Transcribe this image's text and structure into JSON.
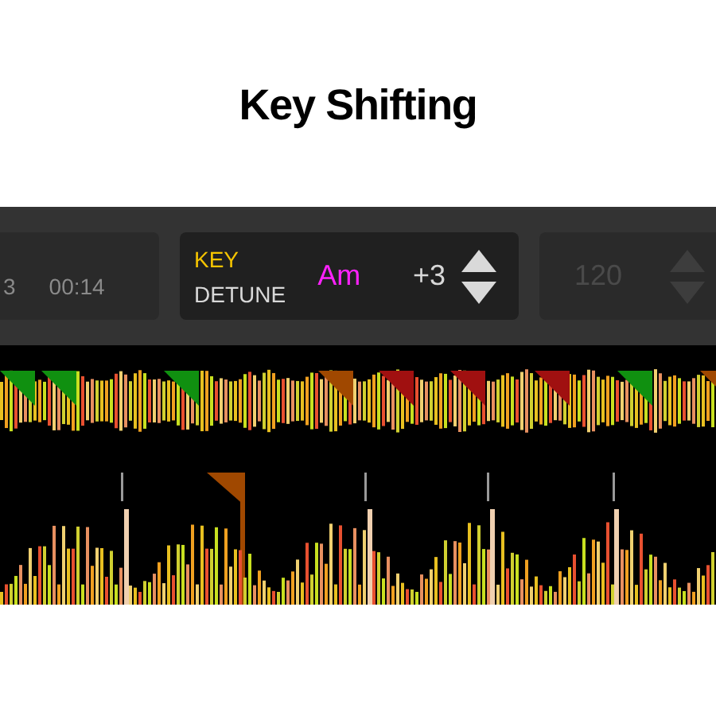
{
  "heading": "Key Shifting",
  "time_panel": {
    "beat_count": "3",
    "elapsed": "00:14"
  },
  "key_panel": {
    "key_label": "KEY",
    "detune_label": "DETUNE",
    "key_value": "Am",
    "shift": "+3"
  },
  "tempo_panel": {
    "bpm": "120",
    "disabled": true
  }
}
